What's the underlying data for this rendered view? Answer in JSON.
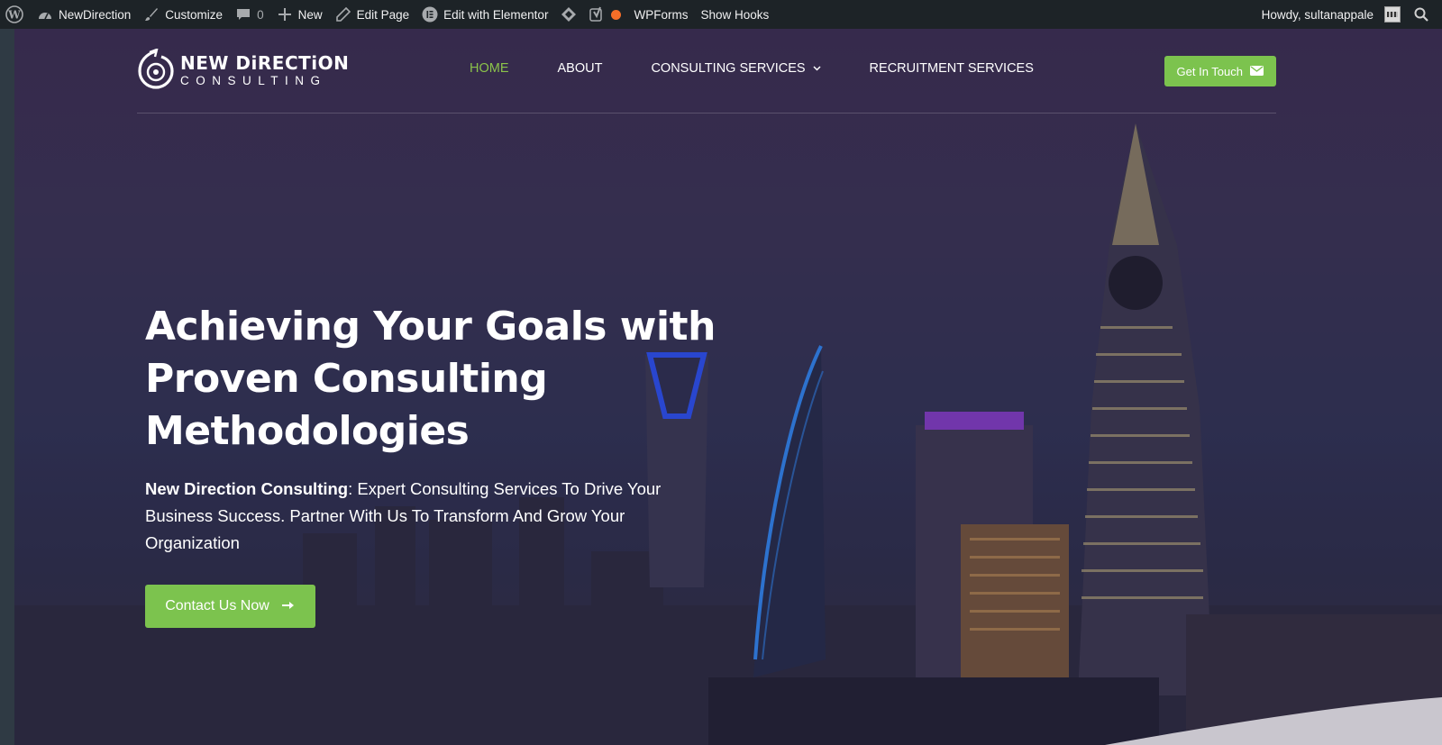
{
  "adminbar": {
    "items": [
      {
        "label": "NewDirection",
        "icon": "dashboard-icon"
      },
      {
        "label": "Customize",
        "icon": "brush-icon"
      },
      {
        "label": "0",
        "icon": "comment-icon"
      },
      {
        "label": "New",
        "icon": "plus-icon"
      },
      {
        "label": "Edit Page",
        "icon": "pencil-icon"
      },
      {
        "label": "Edit with Elementor",
        "icon": "elementor-icon"
      },
      {
        "label": "WPForms",
        "icon": "wpforms-icon"
      },
      {
        "label": "Show Hooks",
        "icon": ""
      }
    ],
    "howdy": "Howdy, sultanappale"
  },
  "header": {
    "logo_line1": "NEW DiRECTiON",
    "logo_line2": "CONSULTING",
    "nav": [
      "HOME",
      "ABOUT",
      "CONSULTING SERVICES",
      "RECRUITMENT SERVICES"
    ],
    "cta_label": "Get In Touch"
  },
  "hero": {
    "title_line1": "Achieving Your Goals with",
    "title_line2": "Proven Consulting",
    "title_line3": "Methodologies",
    "lead_bold": "New Direction Consulting",
    "lead_rest": ": Expert Consulting Services To Drive Your Business Success. Partner With Us To Transform And Grow Your Organization",
    "button_label": "Contact Us Now"
  },
  "colors": {
    "accent": "#7cc34e",
    "adminbar": "#1d2327",
    "nav_active": "#8bc34a"
  }
}
